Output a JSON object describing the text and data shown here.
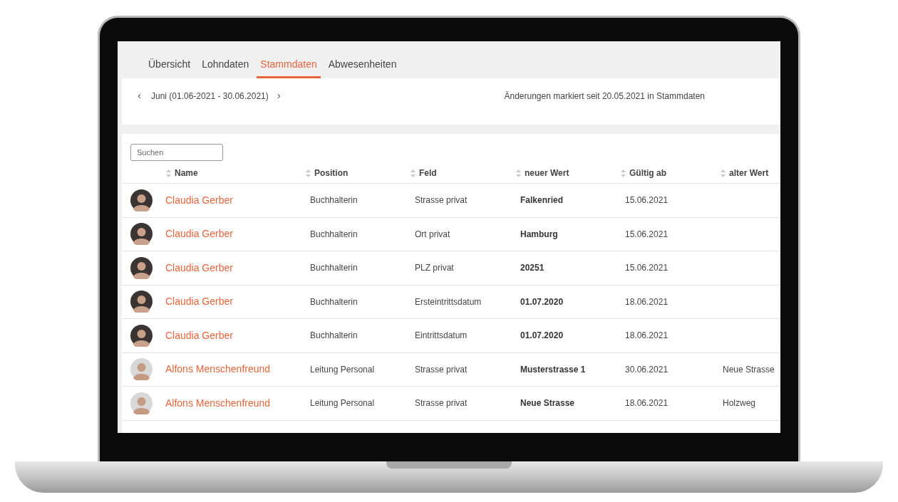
{
  "tabs": [
    {
      "label": "Übersicht",
      "selected": false
    },
    {
      "label": "Lohndaten",
      "selected": false
    },
    {
      "label": "Stammdaten",
      "selected": true
    },
    {
      "label": "Abwesenheiten",
      "selected": false
    }
  ],
  "period": {
    "prev": "‹",
    "label": "Juni (01.06-2021 - 30.06.2021)",
    "next": "›"
  },
  "changes_note": "Änderungen markiert seit 20.05.2021 in Stammdaten",
  "search": {
    "placeholder": "Suchen"
  },
  "table": {
    "columns": [
      "Name",
      "Position",
      "Feld",
      "neuer Wert",
      "Gültig ab",
      "alter Wert"
    ],
    "rows": [
      {
        "kind": "dark",
        "name": "Claudia Gerber",
        "position": "Buchhalterin",
        "field": "Strasse privat",
        "new_value": "Falkenried",
        "valid_from": "15.06.2021"
      },
      {
        "kind": "dark",
        "name": "Claudia Gerber",
        "position": "Buchhalterin",
        "field": "Ort privat",
        "new_value": "Hamburg",
        "valid_from": "15.06.2021"
      },
      {
        "kind": "dark",
        "name": "Claudia Gerber",
        "position": "Buchhalterin",
        "field": "PLZ privat",
        "new_value": "20251",
        "valid_from": "15.06.2021"
      },
      {
        "kind": "dark",
        "name": "Claudia Gerber",
        "position": "Buchhalterin",
        "field": "Ersteintrittsdatum",
        "new_value": "01.07.2020",
        "valid_from": "18.06.2021"
      },
      {
        "kind": "dark",
        "name": "Claudia Gerber",
        "position": "Buchhalterin",
        "field": "Eintrittsdatum",
        "new_value": "01.07.2020",
        "valid_from": "18.06.2021"
      },
      {
        "kind": "light",
        "name": "Alfons Menschenfreund",
        "position": "Leitung Personal",
        "field": "Strasse privat",
        "new_value": "Musterstrasse 1",
        "valid_from": "30.06.2021",
        "old_value": "Neue Strasse"
      },
      {
        "kind": "light",
        "name": "Alfons Menschenfreund",
        "position": "Leitung Personal",
        "field": "Strasse privat",
        "new_value": "Neue Strasse",
        "valid_from": "18.06.2021",
        "old_value": "Holzweg"
      }
    ]
  }
}
